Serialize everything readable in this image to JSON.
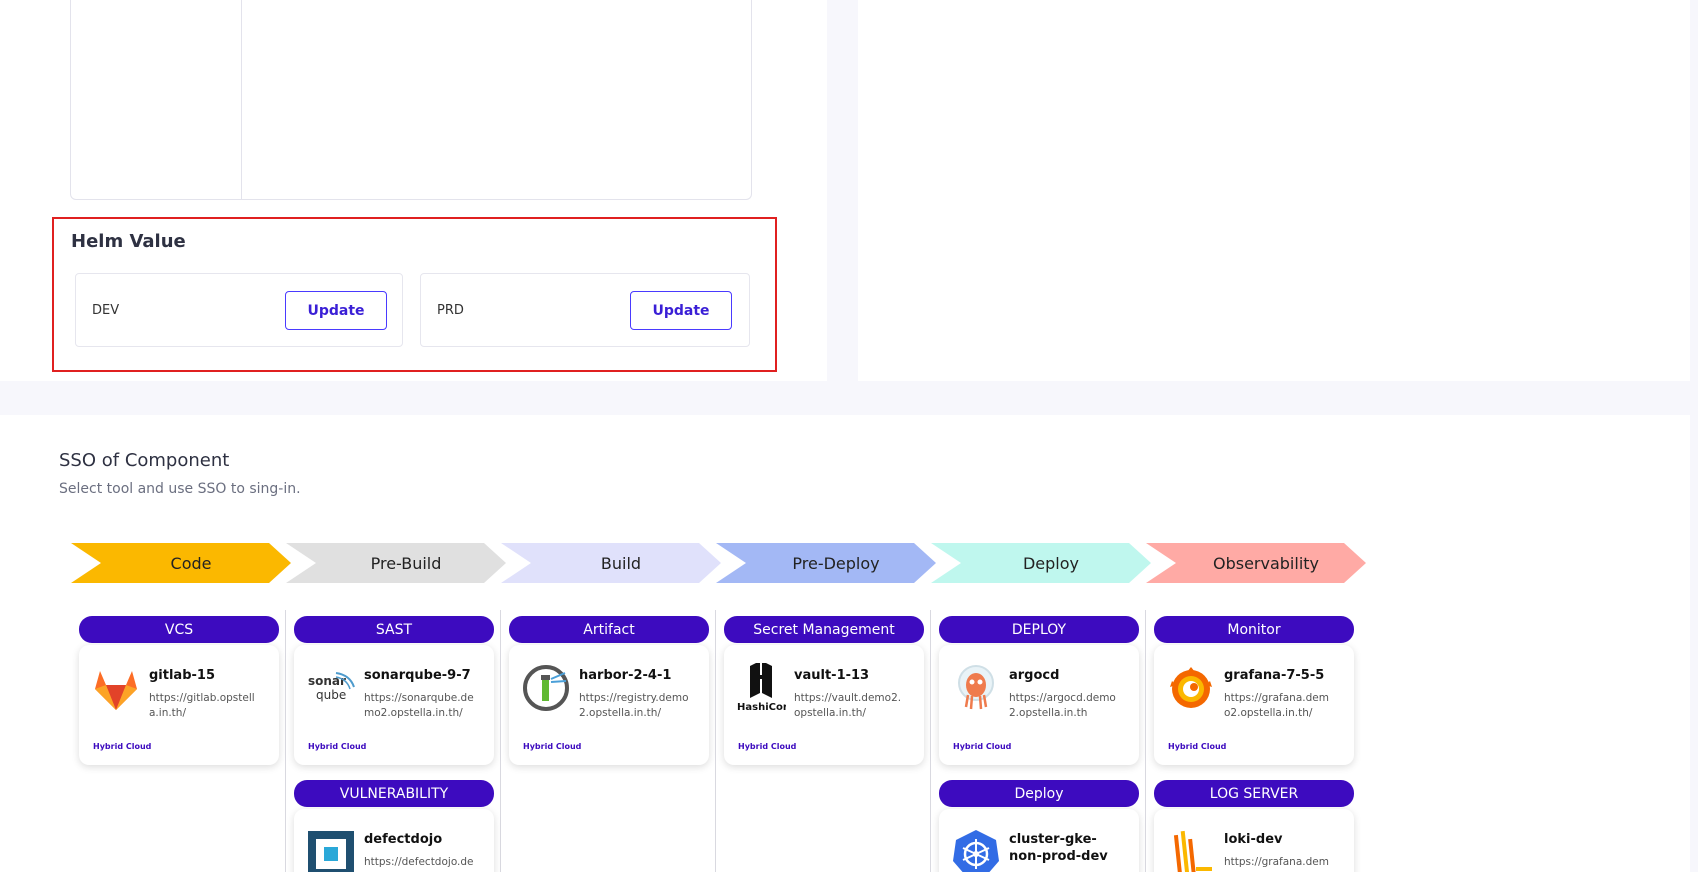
{
  "helm": {
    "title": "Helm Value",
    "envs": [
      {
        "label": "DEV",
        "button": "Update"
      },
      {
        "label": "PRD",
        "button": "Update"
      }
    ]
  },
  "sso": {
    "title": "SSO of Component",
    "subtitle": "Select tool and use SSO to sing-in.",
    "stages": [
      {
        "label": "Code",
        "color": "#fbb800"
      },
      {
        "label": "Pre-Build",
        "color": "#e0e0e0"
      },
      {
        "label": "Build",
        "color": "#e0e1fb"
      },
      {
        "label": "Pre-Deploy",
        "color": "#a3b8f5"
      },
      {
        "label": "Deploy",
        "color": "#bff7ee"
      },
      {
        "label": "Observability",
        "color": "#ffaaa5"
      }
    ],
    "categories": [
      {
        "label": "VCS",
        "tool": {
          "name": "gitlab-15",
          "url": "https://gitlab.opstella.in.th/",
          "tag": "Hybrid Cloud",
          "icon": "gitlab-icon"
        }
      },
      {
        "label": "SAST",
        "tool": {
          "name": "sonarqube-9-7",
          "url": "https://sonarqube.demo2.opstella.in.th/",
          "tag": "Hybrid Cloud",
          "icon": "sonarqube-icon",
          "logo_text": [
            "sonar",
            "qube"
          ]
        }
      },
      {
        "label": "Artifact",
        "tool": {
          "name": "harbor-2-4-1",
          "url": "https://registry.demo2.opstella.in.th/",
          "tag": "Hybrid Cloud",
          "icon": "harbor-icon"
        }
      },
      {
        "label": "Secret Management",
        "tool": {
          "name": "vault-1-13",
          "url": "https://vault.demo2.opstella.in.th/",
          "tag": "Hybrid Cloud",
          "icon": "hashicorp-vault-icon",
          "logo_text": "HashiCorp"
        }
      },
      {
        "label": "DEPLOY",
        "tool": {
          "name": "argocd",
          "url": "https://argocd.demo2.opstella.in.th",
          "tag": "Hybrid Cloud",
          "icon": "argocd-icon"
        }
      },
      {
        "label": "Monitor",
        "tool": {
          "name": "grafana-7-5-5",
          "url": "https://grafana.demo2.opstella.in.th/",
          "tag": "Hybrid Cloud",
          "icon": "grafana-icon"
        }
      }
    ],
    "categories_row2": [
      {
        "label": "VULNERABILITY",
        "tool": {
          "name": "defectdojo",
          "url": "https://defectdojo.de",
          "icon": "defectdojo-icon"
        }
      },
      {
        "label": "Deploy",
        "tool": {
          "name": "cluster-gke-non-prod-dev",
          "url": "",
          "icon": "kubernetes-icon"
        }
      },
      {
        "label": "LOG SERVER",
        "tool": {
          "name": "loki-dev",
          "url": "https://grafana.demo",
          "icon": "loki-icon"
        }
      }
    ]
  }
}
